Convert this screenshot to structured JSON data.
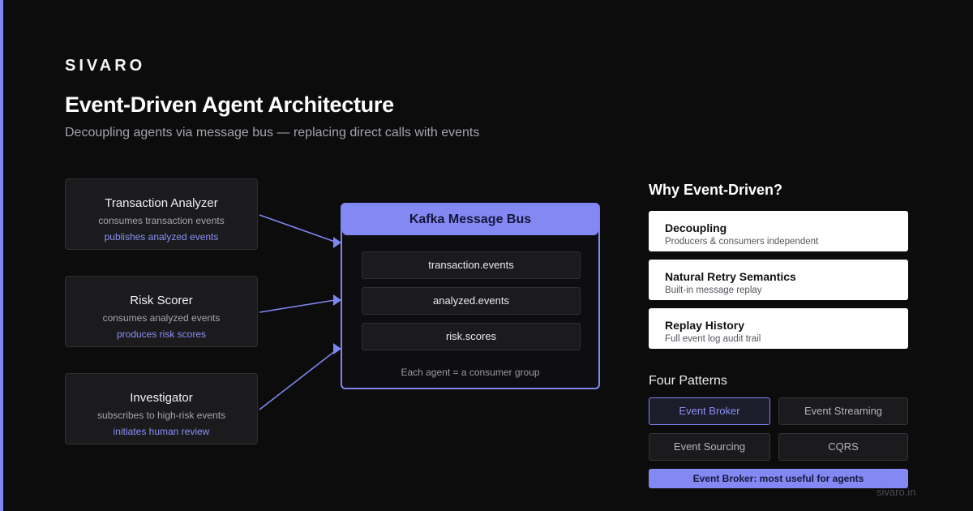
{
  "brand": "SIVARO",
  "title": "Event-Driven Agent Architecture",
  "subtitle": "Decoupling agents via message bus — replacing direct calls with events",
  "agents": [
    {
      "name": "Transaction Analyzer",
      "consumes": "consumes transaction events",
      "emits": "publishes analyzed events"
    },
    {
      "name": "Risk Scorer",
      "consumes": "consumes analyzed events",
      "emits": "produces risk scores"
    },
    {
      "name": "Investigator",
      "consumes": "subscribes to high-risk events",
      "emits": "initiates human review"
    }
  ],
  "bus": {
    "title": "Kafka Message Bus",
    "topics": [
      "transaction.events",
      "analyzed.events",
      "risk.scores"
    ],
    "footnote": "Each agent = a consumer group"
  },
  "why": {
    "title": "Why Event-Driven?",
    "items": [
      {
        "title": "Decoupling",
        "desc": "Producers & consumers independent"
      },
      {
        "title": "Natural Retry Semantics",
        "desc": "Built-in message replay"
      },
      {
        "title": "Replay History",
        "desc": "Full event log audit trail"
      }
    ]
  },
  "patterns": {
    "title": "Four Patterns",
    "items": [
      "Event Broker",
      "Event Streaming",
      "Event Sourcing",
      "CQRS"
    ],
    "selected": "Event Broker",
    "highlight": "Event Broker: most useful for agents"
  },
  "footer": "sivaro.in",
  "colors": {
    "accent": "#7f86f0",
    "background": "#0c0c0d",
    "card": "#1b1b1e"
  }
}
